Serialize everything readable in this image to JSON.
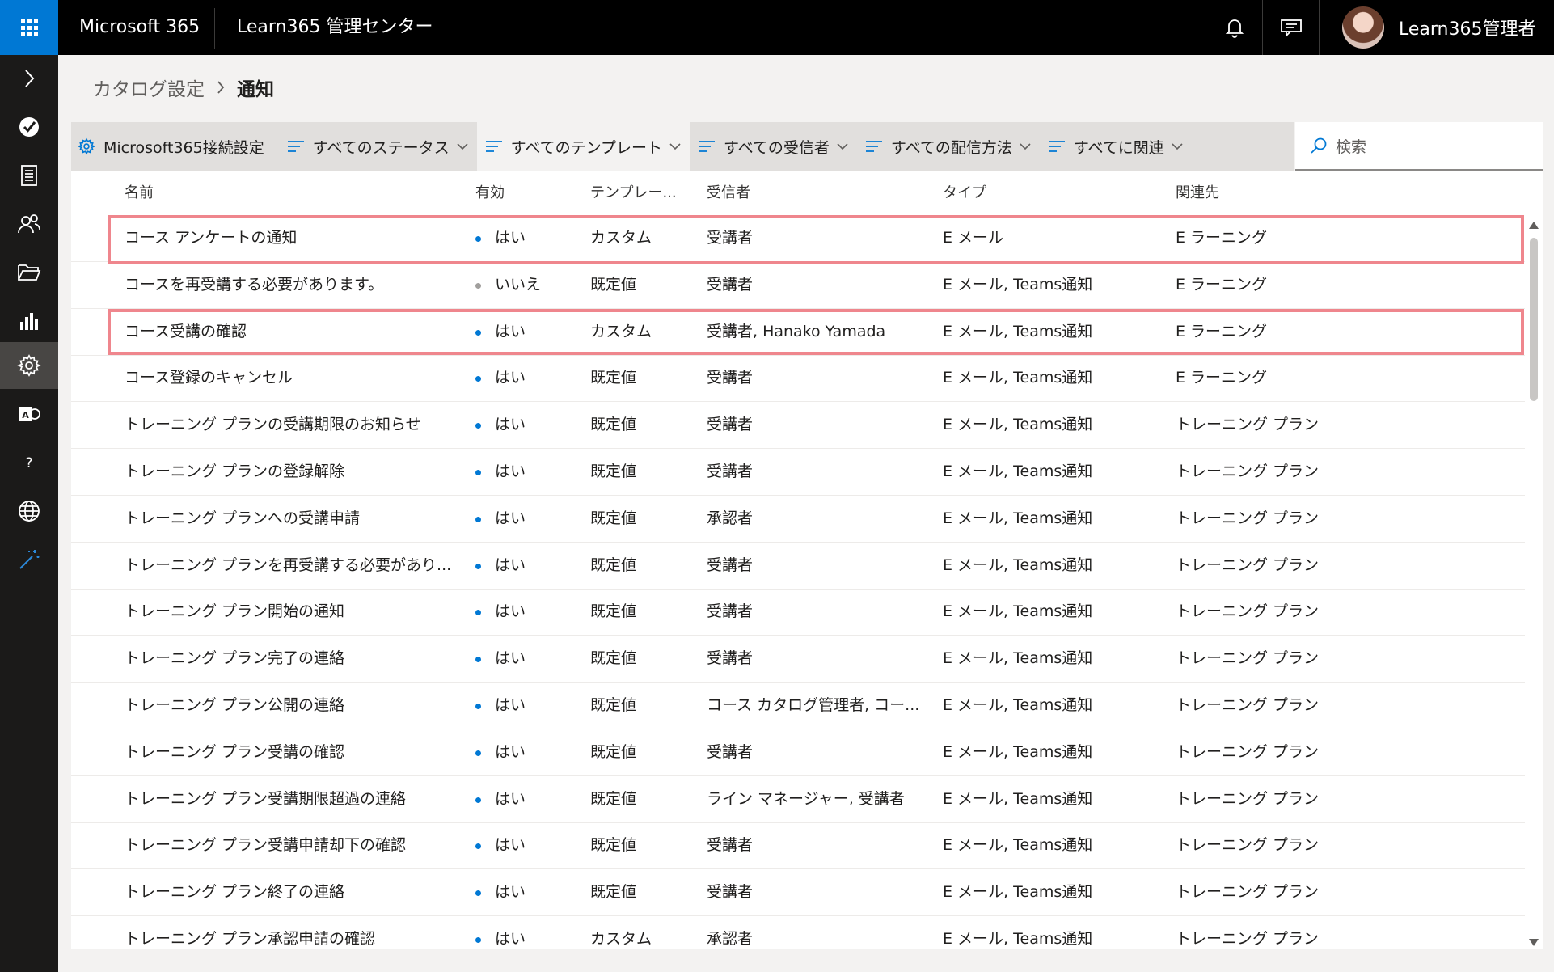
{
  "topbar": {
    "brand": "Microsoft 365",
    "app_title": "Learn365 管理センター",
    "user_name": "Learn365管理者"
  },
  "rail": {
    "items": [
      "expand-icon",
      "check-badge-icon",
      "report-icon",
      "people-icon",
      "folder-icon",
      "bar-chart-icon",
      "settings-icon",
      "office-icon",
      "help-icon",
      "globe-icon",
      "magic-wand-icon"
    ],
    "active": "settings-icon"
  },
  "breadcrumb": {
    "parent": "カタログ設定",
    "current": "通知"
  },
  "toolbar": {
    "connection": "Microsoft365接続設定",
    "filters": [
      "すべてのステータス",
      "すべてのテンプレート",
      "すべての受信者",
      "すべての配信方法",
      "すべてに関連"
    ]
  },
  "search": {
    "placeholder": "検索"
  },
  "columns": [
    "名前",
    "有効",
    "テンプレー...",
    "受信者",
    "タイプ",
    "関連先"
  ],
  "rows": [
    {
      "name": "コース アンケートの通知",
      "enabled": "はい",
      "enabled_on": true,
      "template": "カスタム",
      "recipient": "受講者",
      "type": "E メール",
      "related": "E ラーニング"
    },
    {
      "name": "コースを再受講する必要があります。",
      "enabled": "いいえ",
      "enabled_on": false,
      "template": "既定値",
      "recipient": "受講者",
      "type": "E メール, Teams通知",
      "related": "E ラーニング"
    },
    {
      "name": "コース受講の確認",
      "enabled": "はい",
      "enabled_on": true,
      "template": "カスタム",
      "recipient": "受講者, Hanako Yamada",
      "type": "E メール, Teams通知",
      "related": "E ラーニング"
    },
    {
      "name": "コース登録のキャンセル",
      "enabled": "はい",
      "enabled_on": true,
      "template": "既定値",
      "recipient": "受講者",
      "type": "E メール, Teams通知",
      "related": "E ラーニング"
    },
    {
      "name": "トレーニング プランの受講期限のお知らせ",
      "enabled": "はい",
      "enabled_on": true,
      "template": "既定値",
      "recipient": "受講者",
      "type": "E メール, Teams通知",
      "related": "トレーニング プラン"
    },
    {
      "name": "トレーニング プランの登録解除",
      "enabled": "はい",
      "enabled_on": true,
      "template": "既定値",
      "recipient": "受講者",
      "type": "E メール, Teams通知",
      "related": "トレーニング プラン"
    },
    {
      "name": "トレーニング プランへの受講申請",
      "enabled": "はい",
      "enabled_on": true,
      "template": "既定値",
      "recipient": "承認者",
      "type": "E メール, Teams通知",
      "related": "トレーニング プラン"
    },
    {
      "name": "トレーニング プランを再受講する必要があり...",
      "enabled": "はい",
      "enabled_on": true,
      "template": "既定値",
      "recipient": "受講者",
      "type": "E メール, Teams通知",
      "related": "トレーニング プラン"
    },
    {
      "name": "トレーニング プラン開始の通知",
      "enabled": "はい",
      "enabled_on": true,
      "template": "既定値",
      "recipient": "受講者",
      "type": "E メール, Teams通知",
      "related": "トレーニング プラン"
    },
    {
      "name": "トレーニング プラン完了の連絡",
      "enabled": "はい",
      "enabled_on": true,
      "template": "既定値",
      "recipient": "受講者",
      "type": "E メール, Teams通知",
      "related": "トレーニング プラン"
    },
    {
      "name": "トレーニング プラン公開の連絡",
      "enabled": "はい",
      "enabled_on": true,
      "template": "既定値",
      "recipient": "コース カタログ管理者, コー...",
      "type": "E メール, Teams通知",
      "related": "トレーニング プラン"
    },
    {
      "name": "トレーニング プラン受講の確認",
      "enabled": "はい",
      "enabled_on": true,
      "template": "既定値",
      "recipient": "受講者",
      "type": "E メール, Teams通知",
      "related": "トレーニング プラン"
    },
    {
      "name": "トレーニング プラン受講期限超過の連絡",
      "enabled": "はい",
      "enabled_on": true,
      "template": "既定値",
      "recipient": "ライン マネージャー, 受講者",
      "type": "E メール, Teams通知",
      "related": "トレーニング プラン"
    },
    {
      "name": "トレーニング プラン受講申請却下の確認",
      "enabled": "はい",
      "enabled_on": true,
      "template": "既定値",
      "recipient": "受講者",
      "type": "E メール, Teams通知",
      "related": "トレーニング プラン"
    },
    {
      "name": "トレーニング プラン終了の連絡",
      "enabled": "はい",
      "enabled_on": true,
      "template": "既定値",
      "recipient": "受講者",
      "type": "E メール, Teams通知",
      "related": "トレーニング プラン"
    },
    {
      "name": "トレーニング プラン承認申請の確認",
      "enabled": "はい",
      "enabled_on": true,
      "template": "カスタム",
      "recipient": "承認者",
      "type": "E メール, Teams通知",
      "related": "トレーニング プラン"
    }
  ],
  "highlighted_rows": [
    0,
    2
  ],
  "colors": {
    "accent": "#0078d4",
    "highlight": "#ef868d",
    "topbar": "#000000",
    "rail": "#1b1a19"
  }
}
